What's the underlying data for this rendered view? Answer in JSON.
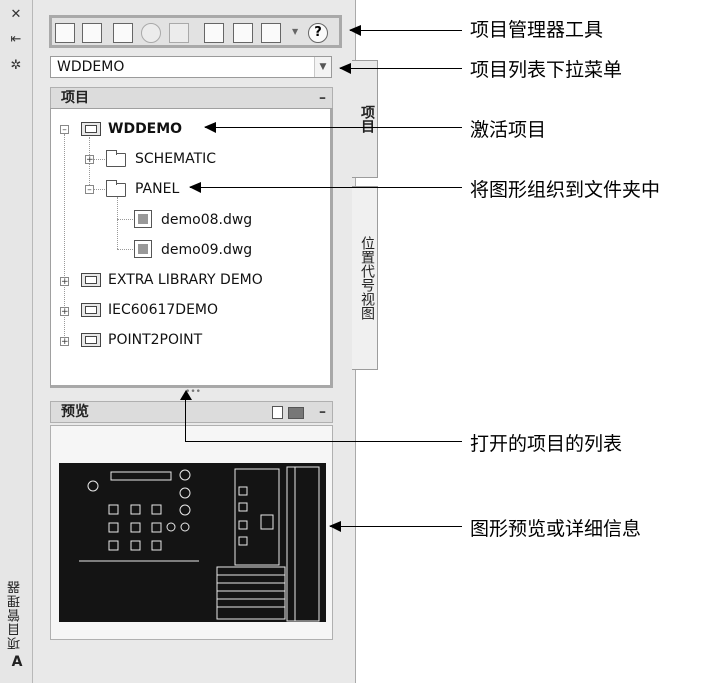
{
  "palette": {
    "title": "项目管理器",
    "close_glyph": "✕",
    "autohide_glyph": "⇤",
    "settings_glyph": "✲",
    "bottom_glyph": "A"
  },
  "toolbar": {
    "icons": [
      "open-project-icon",
      "new-project-icon",
      "new-drawing-icon",
      "refresh-icon",
      "disabled-tool-icon",
      "update-icon",
      "properties-icon",
      "print-icon",
      "help-icon"
    ]
  },
  "project_list": {
    "selected": "WDDEMO"
  },
  "projects_panel": {
    "title": "项目",
    "collapse": "–",
    "tree": {
      "active": "WDDEMO",
      "folders": [
        "SCHEMATIC",
        "PANEL"
      ],
      "files": [
        "demo08.dwg",
        "demo09.dwg"
      ],
      "other_projects": [
        "EXTRA LIBRARY DEMO",
        "IEC60617DEMO",
        "POINT2POINT"
      ]
    },
    "expand_minus": "–",
    "expand_plus": "+"
  },
  "splitter": "•••",
  "preview_panel": {
    "title": "预览",
    "collapse": "–"
  },
  "side_tabs": {
    "projects": "项目",
    "location": "位置代号视图"
  },
  "annotations": {
    "toolbar": "项目管理器工具",
    "dropdown": "项目列表下拉菜单",
    "active": "激活项目",
    "folders": "将图形组织到文件夹中",
    "open_list": "打开的项目的列表",
    "preview": "图形预览或详细信息"
  }
}
